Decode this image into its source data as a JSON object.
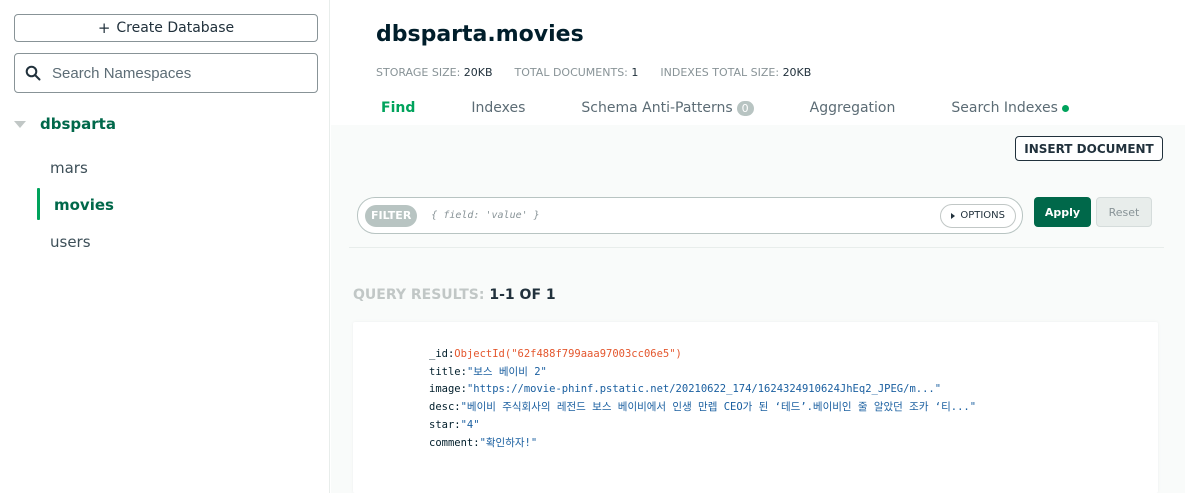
{
  "sidebar": {
    "create_button": "Create Database",
    "create_icon": "plus-icon",
    "search_placeholder": "Search Namespaces",
    "search_icon": "search-icon",
    "database": {
      "name": "dbsparta",
      "expanded": true,
      "collections": [
        "mars",
        "movies",
        "users"
      ],
      "active_collection": "movies"
    }
  },
  "main": {
    "title": "dbsparta.movies",
    "stats": {
      "storage_label": "STORAGE SIZE:",
      "storage_value": "20KB",
      "docs_label": "TOTAL DOCUMENTS:",
      "docs_value": "1",
      "indexes_label": "INDEXES TOTAL SIZE:",
      "indexes_value": "20KB"
    },
    "tabs": {
      "find": "Find",
      "indexes": "Indexes",
      "schema": "Schema Anti-Patterns",
      "schema_badge": "0",
      "aggregation": "Aggregation",
      "search_indexes": "Search Indexes"
    },
    "active_tab": "Find",
    "insert_button": "INSERT DOCUMENT",
    "filter": {
      "label": "FILTER",
      "placeholder": "{ field: 'value' }",
      "options_button": "OPTIONS",
      "apply_button": "Apply",
      "reset_button": "Reset"
    },
    "results": {
      "label": "QUERY RESULTS:",
      "count": "1-1 OF 1"
    },
    "document": {
      "id_key": "_id:",
      "id_value": "ObjectId(\"62f488f799aaa97003cc06e5\")",
      "title_key": "title:",
      "title_value": "\"보스 베이비 2\"",
      "image_key": "image:",
      "image_value": "\"https://movie-phinf.pstatic.net/20210622_174/1624324910624JhEq2_JPEG/m...\"",
      "desc_key": "desc:",
      "desc_value": "\"베이비 주식회사의 레전드 보스 베이비에서 인생 만렙 CEO가 된 ‘테드’.베이비인 줄 알았던 조카 ‘티...\"",
      "star_key": "star:",
      "star_value": "\"4\"",
      "comment_key": "comment:",
      "comment_value": "\"확인하자!\""
    }
  },
  "colors": {
    "accent_green": "#00a35c",
    "dark_green": "#00684a",
    "objectid": "#e4572e",
    "string": "#1a5fa0"
  }
}
